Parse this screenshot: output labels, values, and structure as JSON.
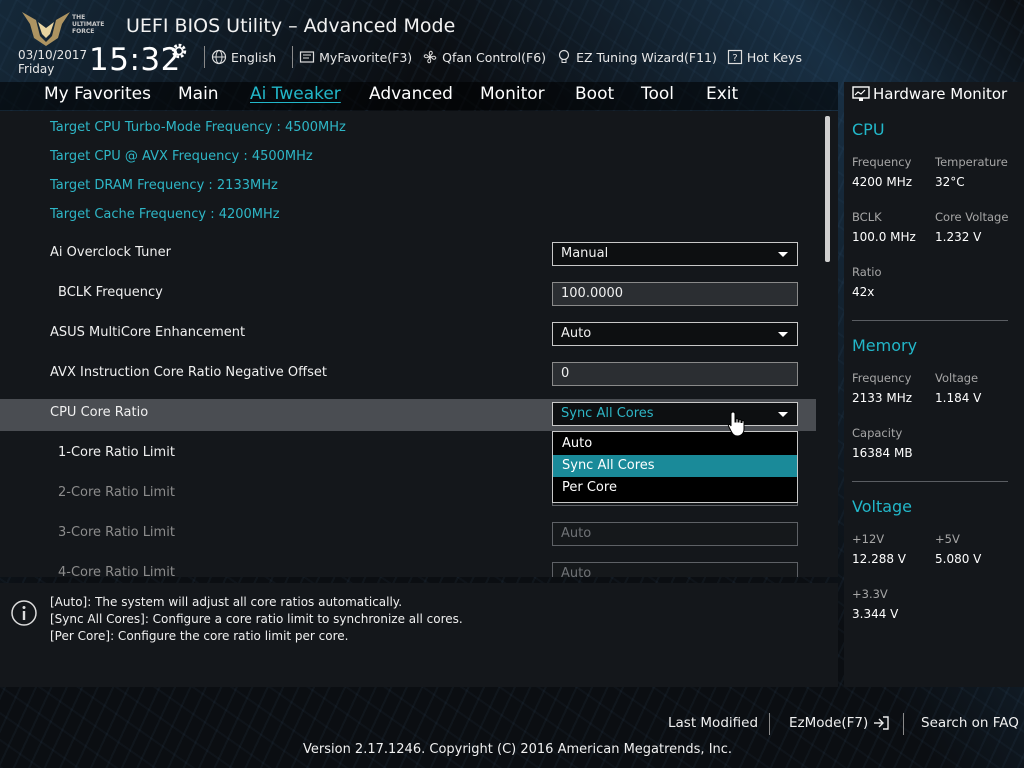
{
  "header": {
    "logo_text": "THE ULTIMATE FORCE",
    "title": "UEFI BIOS Utility – Advanced Mode",
    "date": "03/10/2017",
    "day": "Friday",
    "time": "15:32",
    "tools": [
      {
        "label": "English",
        "icon": "globe-icon"
      },
      {
        "label": "MyFavorite(F3)",
        "icon": "favorite-icon"
      },
      {
        "label": "Qfan Control(F6)",
        "icon": "fan-icon"
      },
      {
        "label": "EZ Tuning Wizard(F11)",
        "icon": "lightbulb-icon"
      },
      {
        "label": "Hot Keys",
        "icon": "help-box-icon"
      }
    ]
  },
  "menu": [
    {
      "label": "My Favorites"
    },
    {
      "label": "Main"
    },
    {
      "label": "Ai Tweaker",
      "active": true
    },
    {
      "label": "Advanced"
    },
    {
      "label": "Monitor"
    },
    {
      "label": "Boot"
    },
    {
      "label": "Tool"
    },
    {
      "label": "Exit"
    }
  ],
  "main": {
    "info": [
      "Target CPU Turbo-Mode Frequency : 4500MHz",
      "Target CPU @ AVX Frequency : 4500MHz",
      "Target DRAM Frequency : 2133MHz",
      "Target Cache Frequency : 4200MHz"
    ],
    "settings": [
      {
        "label": "Ai Overclock Tuner",
        "value": "Manual",
        "kind": "select"
      },
      {
        "label": "BCLK Frequency",
        "value": "100.0000",
        "kind": "input"
      },
      {
        "label": "ASUS MultiCore Enhancement",
        "value": "Auto",
        "kind": "select"
      },
      {
        "label": "AVX Instruction Core Ratio Negative Offset",
        "value": "0",
        "kind": "input"
      },
      {
        "label": "CPU Core Ratio",
        "value": "Sync All Cores",
        "kind": "select"
      },
      {
        "label": "1-Core Ratio Limit",
        "value": "",
        "kind": "hidden"
      },
      {
        "label": "2-Core Ratio Limit",
        "value": "",
        "kind": "hidden"
      },
      {
        "label": "3-Core Ratio Limit",
        "value": "Auto",
        "kind": "disabled"
      },
      {
        "label": "4-Core Ratio Limit",
        "value": "Auto",
        "kind": "disabled"
      }
    ],
    "dropdown_options": [
      "Auto",
      "Sync All Cores",
      "Per Core"
    ],
    "dropdown_selected": "Sync All Cores"
  },
  "help": [
    "[Auto]: The system will adjust all core ratios automatically.",
    "[Sync All Cores]: Configure a core ratio limit to synchronize all cores.",
    "[Per Core]: Configure the core ratio limit per core."
  ],
  "hardware_monitor": {
    "title": "Hardware Monitor",
    "cpu": {
      "heading": "CPU",
      "frequency_label": "Frequency",
      "frequency": "4200 MHz",
      "temperature_label": "Temperature",
      "temperature": "32°C",
      "bclk_label": "BCLK",
      "bclk": "100.0 MHz",
      "core_voltage_label": "Core Voltage",
      "core_voltage": "1.232 V",
      "ratio_label": "Ratio",
      "ratio": "42x"
    },
    "memory": {
      "heading": "Memory",
      "frequency_label": "Frequency",
      "frequency": "2133 MHz",
      "voltage_label": "Voltage",
      "voltage": "1.184 V",
      "capacity_label": "Capacity",
      "capacity": "16384 MB"
    },
    "voltage": {
      "heading": "Voltage",
      "v12_label": "+12V",
      "v12": "12.288 V",
      "v5_label": "+5V",
      "v5": "5.080 V",
      "v33_label": "+3.3V",
      "v33": "3.344 V"
    }
  },
  "footer": {
    "last_modified": "Last Modified",
    "ezmode": "EzMode(F7)",
    "search_faq": "Search on FAQ",
    "version": "Version 2.17.1246. Copyright (C) 2016 American Megatrends, Inc."
  },
  "colors": {
    "accent": "#22b7c9",
    "selection": "#1a8a99",
    "highlight_row": "#4a4d52"
  }
}
